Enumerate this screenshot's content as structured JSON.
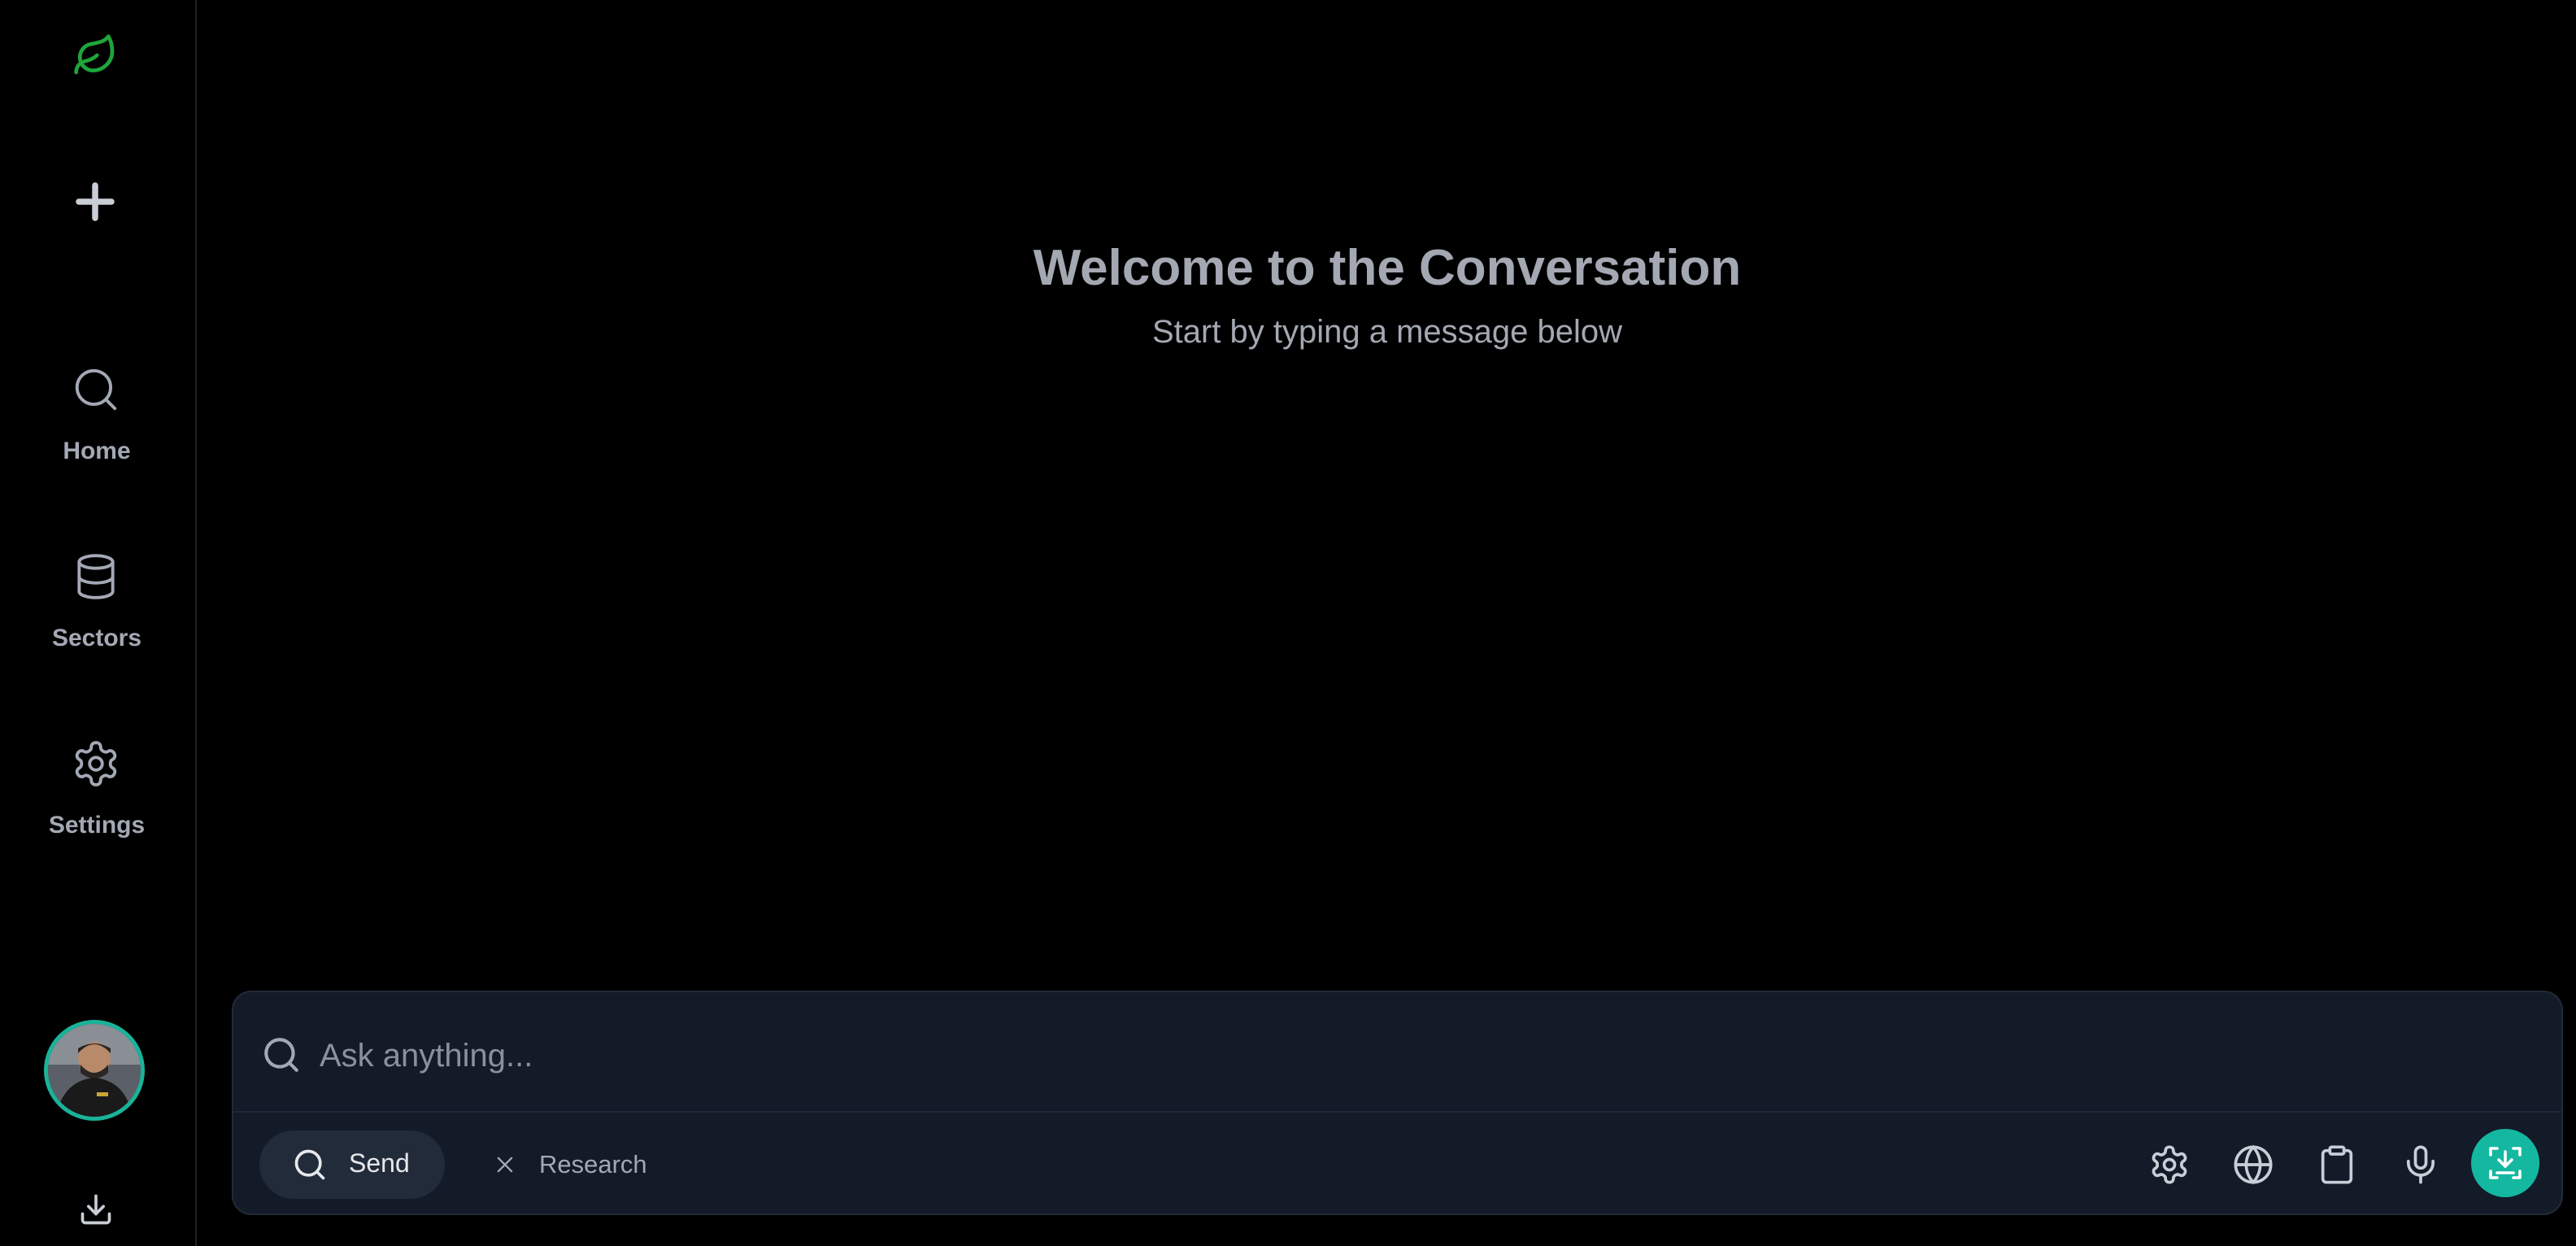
{
  "sidebar": {
    "logo_icon": "leaf-icon",
    "new_chat_icon": "plus-icon",
    "items": [
      {
        "label": "Home",
        "icon": "search-icon"
      },
      {
        "label": "Sectors",
        "icon": "database-icon"
      },
      {
        "label": "Settings",
        "icon": "gear-icon"
      }
    ],
    "avatar_icon": "user-avatar",
    "download_icon": "download-icon"
  },
  "main": {
    "title": "Welcome to the Conversation",
    "subtitle": "Start by typing a message below"
  },
  "composer": {
    "placeholder": "Ask anything...",
    "input_value": "",
    "send_label": "Send",
    "research_label": "Research",
    "tools": [
      "gear-icon",
      "globe-icon",
      "clipboard-icon",
      "microphone-icon"
    ],
    "primary_icon": "focus-icon"
  },
  "colors": {
    "background": "#000000",
    "accent": "#14b8a0",
    "logo_green": "#1fa53a",
    "composer_bg": "#131a28",
    "text_muted": "#a3a8b2"
  }
}
